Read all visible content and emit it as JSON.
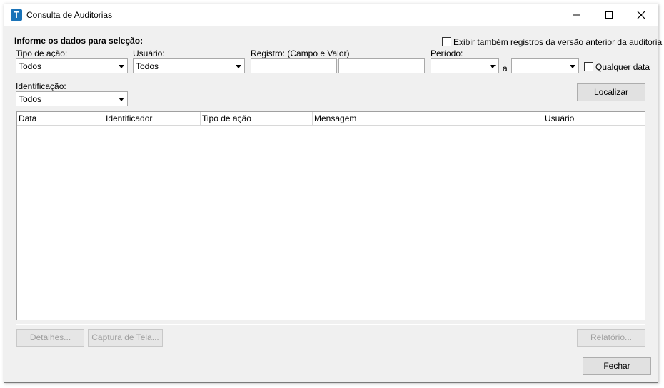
{
  "window": {
    "title": "Consulta de Auditorias"
  },
  "filters": {
    "section_title": "Informe os dados para seleção:",
    "show_previous_label": "Exibir também registros da versão anterior da auditoria",
    "action_type": {
      "label": "Tipo de ação:",
      "value": "Todos"
    },
    "user": {
      "label": "Usuário:",
      "value": "Todos"
    },
    "record": {
      "label": "Registro: (Campo e Valor)",
      "field_value": "",
      "value_value": ""
    },
    "period": {
      "label": "Período:",
      "from": "",
      "separator": "a",
      "to": "",
      "any_date_label": "Qualquer data"
    },
    "identification": {
      "label": "Identificação:",
      "value": "Todos"
    },
    "search_button": "Localizar"
  },
  "grid": {
    "columns": [
      "Data",
      "Identificador",
      "Tipo de ação",
      "Mensagem",
      "Usuário"
    ],
    "rows": []
  },
  "bottom": {
    "details_button": "Detalhes...",
    "capture_button": "Captura de Tela...",
    "report_button": "Relatório...",
    "close_button": "Fechar"
  }
}
